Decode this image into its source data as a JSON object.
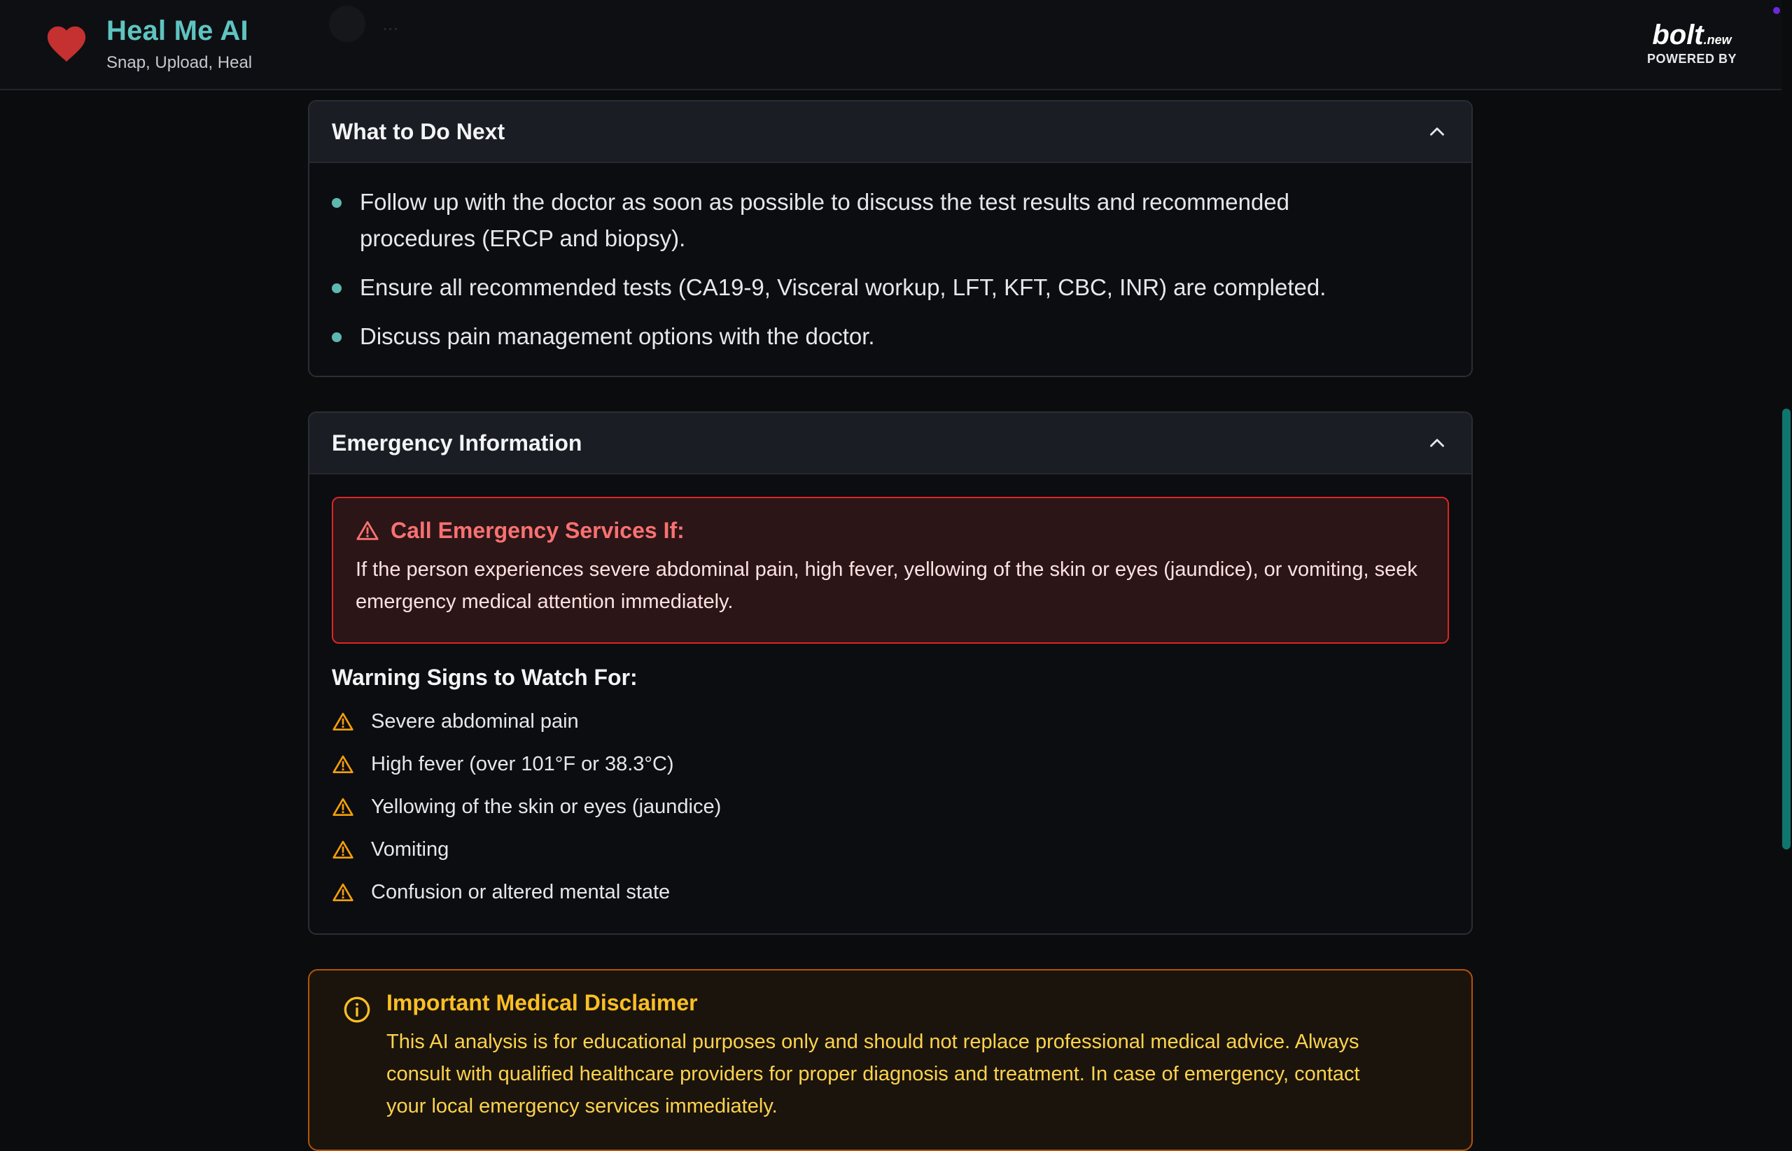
{
  "header": {
    "title": "Heal Me AI",
    "subtitle": "Snap, Upload, Heal",
    "ghost_text": "...",
    "bolt": {
      "mark": "bolt",
      "suffix": ".new",
      "powered_by": "POWERED BY"
    }
  },
  "icons": {
    "logo": "heart-icon",
    "collapse": "chevron-up-icon",
    "alert": "warning-triangle-icon",
    "warning": "warning-triangle-icon",
    "disclaimer": "info-circle-icon"
  },
  "colors": {
    "brand": "#5fc4c0",
    "heart": "#c53030",
    "alert_border": "#dc2626",
    "alert_title": "#f87171",
    "warning_icon": "#f59e0b",
    "disclaimer_border": "#b45309",
    "disclaimer_text": "#fcd34d",
    "scrollbar": "#0f766e"
  },
  "next_steps": {
    "title": "What to Do Next",
    "items": [
      "Follow up with the doctor as soon as possible to discuss the test results and recommended procedures (ERCP and biopsy).",
      "Ensure all recommended tests (CA19-9, Visceral workup, LFT, KFT, CBC, INR) are completed.",
      "Discuss pain management options with the doctor."
    ]
  },
  "emergency": {
    "title": "Emergency Information",
    "alert_title": "Call Emergency Services If:",
    "alert_text": "If the person experiences severe abdominal pain, high fever, yellowing of the skin or eyes (jaundice), or vomiting, seek emergency medical attention immediately.",
    "warning_heading": "Warning Signs to Watch For:",
    "warning_signs": [
      "Severe abdominal pain",
      "High fever (over 101°F or 38.3°C)",
      "Yellowing of the skin or eyes (jaundice)",
      "Vomiting",
      "Confusion or altered mental state"
    ]
  },
  "disclaimer": {
    "title": "Important Medical Disclaimer",
    "text": "This AI analysis is for educational purposes only and should not replace professional medical advice. Always consult with qualified healthcare providers for proper diagnosis and treatment. In case of emergency, contact your local emergency services immediately."
  }
}
